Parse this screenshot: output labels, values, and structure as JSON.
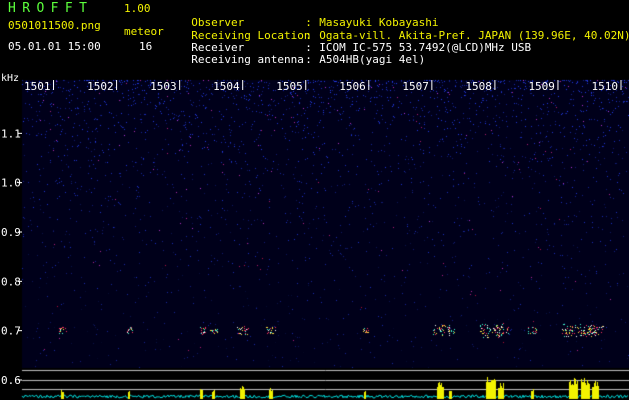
{
  "header": {
    "app_name": "HROFFT",
    "app_version": "1.00",
    "file_name": "0501011500.png",
    "meteor_label": "meteor",
    "timestamp": "05.01.01 15:00",
    "meteor_count": "16",
    "info": [
      {
        "label": "Observer",
        "value": "Masayuki Kobayashi"
      },
      {
        "label": "Receiving Location",
        "value": "Ogata-vill. Akita-Pref. JAPAN (139.96E, 40.02N)"
      },
      {
        "label": "Receiver",
        "value": "ICOM IC-575 53.7492(@LCD)MHz USB"
      },
      {
        "label": "Receiving antenna",
        "value": "A504HB(yagi 4el)"
      }
    ]
  },
  "colors": {
    "header_text": "#f2f200",
    "info_text": "#ffffff",
    "app_name": "#5cff3c",
    "spectrogram_bg": "#00001a",
    "noise": "#2a3cff",
    "level_trace": "#00e0e0",
    "meteor_burst": "#f2f200"
  },
  "chart_data": {
    "type": "heatmap",
    "title": "",
    "x_unit": "minutes (hhmm)",
    "x_ticks": [
      "1501",
      "1502",
      "1503",
      "1504",
      "1505",
      "1506",
      "1507",
      "1508",
      "1509",
      "1510"
    ],
    "y_unit": "kHz",
    "y_ticks": [
      1.1,
      1.0,
      0.9,
      0.8,
      0.7,
      0.6
    ],
    "ylim": [
      0.6,
      1.2
    ],
    "xlim": [
      1500.5,
      1510
    ],
    "grid": false,
    "echo_frequency_khz": 0.7,
    "meteor_echoes": [
      {
        "time": 1501.15,
        "strength": 0.25
      },
      {
        "time": 1502.2,
        "strength": 0.2
      },
      {
        "time": 1503.35,
        "strength": 0.3
      },
      {
        "time": 1503.55,
        "strength": 0.25
      },
      {
        "time": 1504.0,
        "strength": 0.45
      },
      {
        "time": 1504.45,
        "strength": 0.35
      },
      {
        "time": 1505.95,
        "strength": 0.2
      },
      {
        "time": 1507.15,
        "strength": 0.7
      },
      {
        "time": 1507.3,
        "strength": 0.25
      },
      {
        "time": 1507.95,
        "strength": 1.0
      },
      {
        "time": 1508.1,
        "strength": 0.6
      },
      {
        "time": 1508.6,
        "strength": 0.3
      },
      {
        "time": 1509.25,
        "strength": 0.9
      },
      {
        "time": 1509.45,
        "strength": 0.85
      },
      {
        "time": 1509.6,
        "strength": 0.7
      }
    ]
  }
}
